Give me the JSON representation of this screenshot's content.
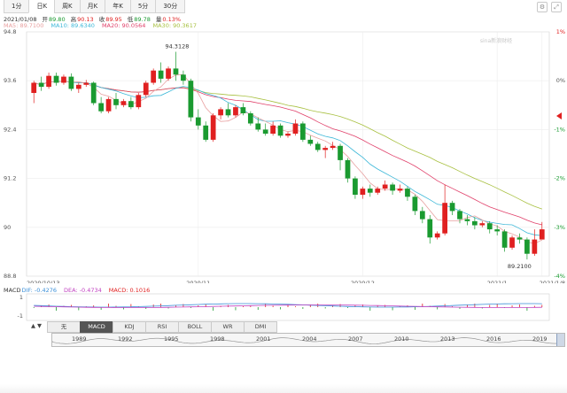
{
  "tabs": [
    "1分",
    "日K",
    "周K",
    "月K",
    "年K",
    "5分",
    "30分"
  ],
  "active_tab": 1,
  "info": {
    "date": "2021/01/08",
    "open_label": "开",
    "open": "89.80",
    "high_label": "高",
    "high": "90.13",
    "close_label": "收",
    "close": "89.95",
    "low_label": "低",
    "low": "89.78",
    "change_label": "量",
    "change": "0.13%"
  },
  "ma": {
    "ma5": "MA5: 89.7100",
    "ma10": "MA10: 89.6340",
    "ma20": "MA20: 90.0564",
    "ma30": "MA30: 90.3617"
  },
  "colors": {
    "up": "#e02020",
    "down": "#1a9a30",
    "ma5": "#e8a0a0",
    "ma10": "#3db8d8",
    "ma20": "#e0406a",
    "ma30": "#a8c040",
    "dif": "#3b8fd8",
    "dea": "#c040c0",
    "macd": "#e02020"
  },
  "watermark": "sina新浪财经",
  "chart_data": {
    "type": "candlestick",
    "y_axis_ticks": [
      "94.8",
      "93.6",
      "92.4",
      "91.2",
      "90",
      "88.8"
    ],
    "y_axis_pct_ticks": [
      "1%",
      "0%",
      "-1%",
      "-2%",
      "-3%",
      "-4%"
    ],
    "x_axis_labels": [
      "2020/10/13",
      "2020/11",
      "2020/12",
      "2021/1",
      "2021/1/8"
    ],
    "ylim": [
      88.8,
      94.8
    ],
    "annotations": [
      {
        "label": "94.3128",
        "value": 94.3128
      },
      {
        "label": "89.2100",
        "value": 89.21
      }
    ],
    "ohlc": [
      [
        93.3,
        93.6,
        93.55,
        93.05
      ],
      [
        93.55,
        93.7,
        93.45,
        93.35
      ],
      [
        93.45,
        93.8,
        93.72,
        93.4
      ],
      [
        93.72,
        93.8,
        93.55,
        93.48
      ],
      [
        93.55,
        93.75,
        93.7,
        93.5
      ],
      [
        93.7,
        93.78,
        93.4,
        93.35
      ],
      [
        93.4,
        93.55,
        93.5,
        93.3
      ],
      [
        93.5,
        93.62,
        93.55,
        93.45
      ],
      [
        93.55,
        93.58,
        93.05,
        93.0
      ],
      [
        93.05,
        93.2,
        92.85,
        92.8
      ],
      [
        92.85,
        93.2,
        93.15,
        92.8
      ],
      [
        93.15,
        93.3,
        93.0,
        92.9
      ],
      [
        93.0,
        93.15,
        93.1,
        92.95
      ],
      [
        93.1,
        93.2,
        92.95,
        92.9
      ],
      [
        92.95,
        93.3,
        93.25,
        92.9
      ],
      [
        93.25,
        93.6,
        93.55,
        93.2
      ],
      [
        93.55,
        93.9,
        93.85,
        93.5
      ],
      [
        93.85,
        94.05,
        93.65,
        93.55
      ],
      [
        93.65,
        93.95,
        93.9,
        93.6
      ],
      [
        93.9,
        94.31,
        93.75,
        93.6
      ],
      [
        93.75,
        93.85,
        93.6,
        93.5
      ],
      [
        93.6,
        93.65,
        92.7,
        92.6
      ],
      [
        92.7,
        92.9,
        92.5,
        92.4
      ],
      [
        92.5,
        92.6,
        92.15,
        92.1
      ],
      [
        92.15,
        92.8,
        92.75,
        92.1
      ],
      [
        92.75,
        92.95,
        92.9,
        92.65
      ],
      [
        92.9,
        93.05,
        92.75,
        92.7
      ],
      [
        92.75,
        93.0,
        92.95,
        92.7
      ],
      [
        92.95,
        93.05,
        92.8,
        92.75
      ],
      [
        92.8,
        92.85,
        92.55,
        92.5
      ],
      [
        92.55,
        92.7,
        92.4,
        92.35
      ],
      [
        92.4,
        92.55,
        92.3,
        92.25
      ],
      [
        92.3,
        92.6,
        92.5,
        92.25
      ],
      [
        92.5,
        92.55,
        92.25,
        92.2
      ],
      [
        92.25,
        92.35,
        92.3,
        92.2
      ],
      [
        92.3,
        92.65,
        92.55,
        92.25
      ],
      [
        92.55,
        92.6,
        92.15,
        92.1
      ],
      [
        92.15,
        92.25,
        92.05,
        92.0
      ],
      [
        92.05,
        92.1,
        91.9,
        91.85
      ],
      [
        91.9,
        92.0,
        91.95,
        91.7
      ],
      [
        91.95,
        92.1,
        92.0,
        91.9
      ],
      [
        92.0,
        92.05,
        91.65,
        91.4
      ],
      [
        91.65,
        91.7,
        91.2,
        91.1
      ],
      [
        91.2,
        91.25,
        90.8,
        90.7
      ],
      [
        90.8,
        91.0,
        90.95,
        90.7
      ],
      [
        90.95,
        91.05,
        90.85,
        90.75
      ],
      [
        90.85,
        91.0,
        90.95,
        90.8
      ],
      [
        90.95,
        91.15,
        91.05,
        90.9
      ],
      [
        91.05,
        91.1,
        90.9,
        90.8
      ],
      [
        90.9,
        91.05,
        90.95,
        90.85
      ],
      [
        90.95,
        91.0,
        90.75,
        90.65
      ],
      [
        90.75,
        90.8,
        90.4,
        90.3
      ],
      [
        90.4,
        90.5,
        90.2,
        90.1
      ],
      [
        90.2,
        90.3,
        89.75,
        89.6
      ],
      [
        89.75,
        89.9,
        89.85,
        89.7
      ],
      [
        89.85,
        91.05,
        90.6,
        89.8
      ],
      [
        90.6,
        90.65,
        90.4,
        90.3
      ],
      [
        90.4,
        90.45,
        90.2,
        90.1
      ],
      [
        90.2,
        90.3,
        90.15,
        90.05
      ],
      [
        90.15,
        90.25,
        90.05,
        89.95
      ],
      [
        90.05,
        90.15,
        90.1,
        90.0
      ],
      [
        90.1,
        90.15,
        89.95,
        89.85
      ],
      [
        89.95,
        90.05,
        89.9,
        89.8
      ],
      [
        89.9,
        89.95,
        89.5,
        89.4
      ],
      [
        89.5,
        89.8,
        89.75,
        89.45
      ],
      [
        89.75,
        89.85,
        89.7,
        89.6
      ],
      [
        89.7,
        89.75,
        89.35,
        89.21
      ],
      [
        89.35,
        89.95,
        89.7,
        89.3
      ],
      [
        89.7,
        90.13,
        89.95,
        89.78
      ]
    ],
    "macd_axis_ticks": [
      "1",
      "-1"
    ],
    "macd_dif": "DIF: -0.4276",
    "macd_dea": "DEA: -0.4734",
    "macd_macd": "MACD: 0.1016",
    "macd_label": "MACD"
  },
  "indicator_tabs": [
    "无",
    "MACD",
    "KDJ",
    "RSI",
    "BOLL",
    "WR",
    "DMI"
  ],
  "indicator_active": 1,
  "nav_years": [
    "1989",
    "1992",
    "1995",
    "1998",
    "2001",
    "2004",
    "2007",
    "2010",
    "2013",
    "2016",
    "2019"
  ]
}
